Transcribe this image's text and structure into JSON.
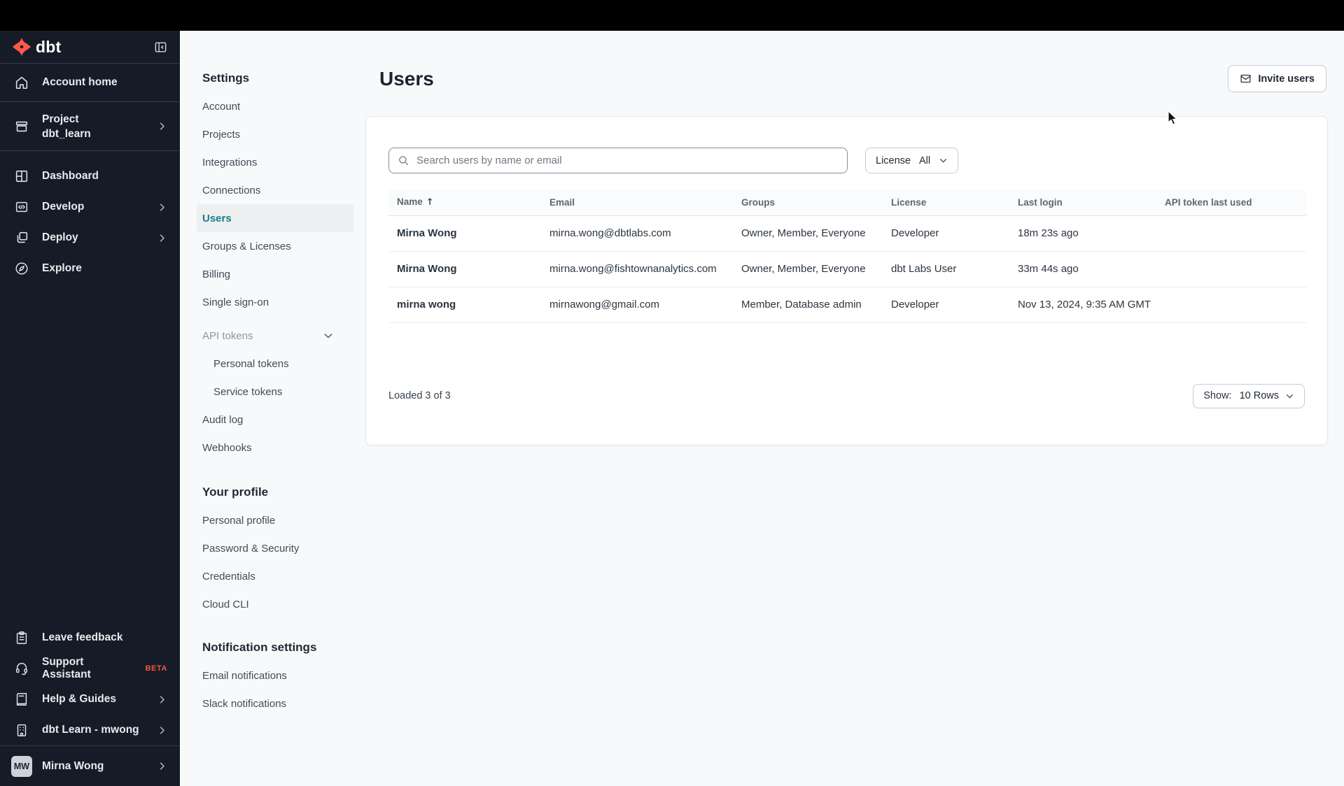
{
  "brand": {
    "logo_text": "dbt",
    "accent_color": "#ff5a47",
    "selected_teal": "#13808a"
  },
  "sidebar": {
    "items": [
      {
        "label": "Account home",
        "icon": "home"
      },
      {
        "label": "Project",
        "sublabel": "dbt_learn",
        "icon": "project-box"
      },
      {
        "label": "Dashboard",
        "icon": "dashboard-grid"
      },
      {
        "label": "Develop",
        "icon": "code-window"
      },
      {
        "label": "Deploy",
        "icon": "deploy-squares"
      },
      {
        "label": "Explore",
        "icon": "compass"
      }
    ],
    "footer_items": [
      {
        "label": "Leave feedback",
        "icon": "clipboard"
      },
      {
        "label": "Support Assistant",
        "badge": "BETA",
        "icon": "headset"
      },
      {
        "label": "Help & Guides",
        "icon": "book"
      },
      {
        "label": "dbt Learn - mwong",
        "icon": "building"
      }
    ],
    "user": {
      "initials": "MW",
      "name": "Mirna Wong"
    }
  },
  "settings_nav": {
    "heading": "Settings",
    "items": [
      "Account",
      "Projects",
      "Integrations",
      "Connections",
      "Users",
      "Groups & Licenses",
      "Billing",
      "Single sign-on"
    ],
    "selected_item": "Users",
    "api_tokens": {
      "label": "API tokens",
      "children": [
        "Personal tokens",
        "Service tokens"
      ]
    },
    "items_after": [
      "Audit log",
      "Webhooks"
    ],
    "profile_heading": "Your profile",
    "profile_items": [
      "Personal profile",
      "Password & Security",
      "Credentials",
      "Cloud CLI"
    ],
    "notifications_heading": "Notification settings",
    "notification_items": [
      "Email notifications",
      "Slack notifications"
    ]
  },
  "header": {
    "title": "Users",
    "invite_button_label": "Invite users"
  },
  "filters": {
    "search_placeholder": "Search users by name or email",
    "license_label": "License",
    "license_value": "All"
  },
  "users_table": {
    "columns": [
      "Name",
      "Email",
      "Groups",
      "License",
      "Last login",
      "API token last used"
    ],
    "sorted_column": "Name",
    "sort_direction": "ascending",
    "rows": [
      {
        "name": "Mirna Wong",
        "email": "mirna.wong@dbtlabs.com",
        "groups": "Owner, Member, Everyone",
        "license": "Developer",
        "last_login": "18m 23s ago",
        "api_token_last_used": ""
      },
      {
        "name": "Mirna Wong",
        "email": "mirna.wong@fishtownanalytics.com",
        "groups": "Owner, Member, Everyone",
        "license": "dbt Labs User",
        "last_login": "33m 44s ago",
        "api_token_last_used": ""
      },
      {
        "name": "mirna wong",
        "email": "mirnawong@gmail.com",
        "groups": "Member, Database admin",
        "license": "Developer",
        "last_login": "Nov 13, 2024, 9:35 AM GMT",
        "api_token_last_used": ""
      }
    ],
    "footer": {
      "loaded_text": "Loaded 3 of 3",
      "show_label": "Show:",
      "show_value": "10 Rows"
    }
  }
}
